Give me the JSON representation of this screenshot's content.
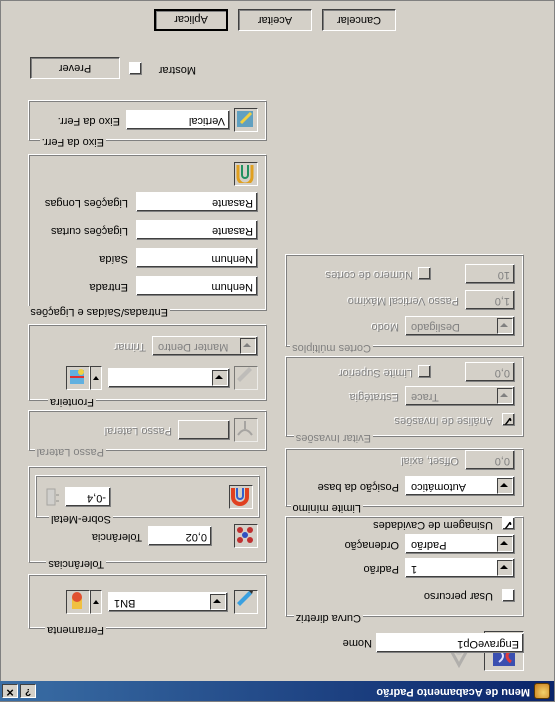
{
  "window": {
    "title": "Menu de Acabamento Padrão"
  },
  "name": {
    "label": "Nome",
    "value": "EngraveOp1"
  },
  "curva_diretriz": {
    "caption": "Curva diretriz",
    "usar_percurso": "Usar percurso",
    "padrao_label": "Padrão",
    "padrao_value": "1",
    "ordenacao_label": "Ordenação",
    "ordenacao_value": "Padrão",
    "usinagem_cavidades": "Usinagem de Cavidades"
  },
  "limite_minimo": {
    "caption": "Limite mínimo",
    "posicao_label": "Posição da base",
    "posicao_value": "Automático",
    "offset_label": "Offset, axial",
    "offset_value": "0,0"
  },
  "evitar_invasoes": {
    "caption": "Evitar Invasões",
    "analise": "Análise de Invasões",
    "estrategia_label": "Estratégia",
    "estrategia_value": "Trace",
    "limite_label": "Limite Superior",
    "limite_value": "0,0"
  },
  "cortes_multiplos": {
    "caption": "Cortes múltiplos",
    "modo_label": "Modo",
    "modo_value": "Desligado",
    "passo_label": "Passo Vertical Máximo",
    "passo_value": "1,0",
    "numero_label": "Número de cortes",
    "numero_value": "10"
  },
  "ferramenta": {
    "caption": "Ferramenta",
    "value": "BN1"
  },
  "tolerancias": {
    "caption": "Tolerâncias",
    "tol_label": "Tolerância",
    "tol_value": "0,02",
    "sobre_metal_caption": "Sobre-Metal",
    "sobre_metal_value": "-0,4"
  },
  "passo_lateral": {
    "caption": "Passo Lateral",
    "label": "Passo Lateral",
    "value": ""
  },
  "fronteira": {
    "caption": "Fronteira",
    "trimar_label": "Trimar",
    "trimar_value": "Manter Dentro",
    "value": ""
  },
  "entradas": {
    "caption": "Entradas/Saídas e Ligações",
    "entrada_label": "Entrada",
    "entrada_value": "Nenhum",
    "saida_label": "Saída",
    "saida_value": "Nenhum",
    "ligacoes_curtas_label": "Ligações curtas",
    "ligacoes_curtas_value": "Rasante",
    "ligacoes_longas_label": "Ligações Longas",
    "ligacoes_longas_value": "Rasante"
  },
  "eixo": {
    "caption": "Eixo da Ferr.",
    "label": "Eixo da Ferr.",
    "value": "Vertical"
  },
  "preview": {
    "button": "Prever",
    "mostrar": "Mostrar"
  },
  "actions": {
    "aplicar": "Aplicar",
    "aceitar": "Aceitar",
    "cancelar": "Cancelar"
  },
  "titlebar_buttons": {
    "help": "?",
    "close": "✕"
  },
  "colors": {
    "titlebar_start": "#0a246a",
    "titlebar_end": "#3a6ea5",
    "face": "#d4d0c8"
  }
}
